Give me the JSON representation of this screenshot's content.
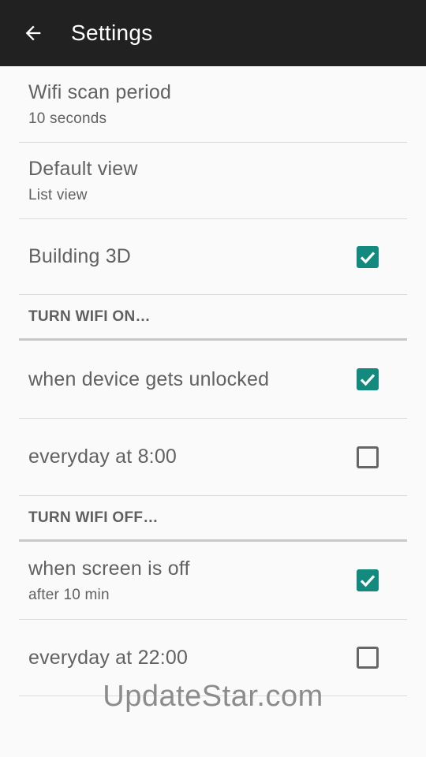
{
  "toolbar": {
    "title": "Settings",
    "back_icon": "arrow-back-icon"
  },
  "general": {
    "wifi_scan": {
      "title": "Wifi scan period",
      "summary": "10 seconds"
    },
    "default_view": {
      "title": "Default view",
      "summary": "List view"
    },
    "building_3d": {
      "title": "Building 3D",
      "checked": true
    }
  },
  "turn_on": {
    "header": "TURN WIFI ON…",
    "unlocked": {
      "title": "when device gets unlocked",
      "checked": true
    },
    "morning": {
      "title": "everyday at 8:00",
      "checked": false
    }
  },
  "turn_off": {
    "header": "TURN WIFI OFF…",
    "screen_off": {
      "title": "when screen is off",
      "summary": "after 10 min",
      "checked": true
    },
    "evening": {
      "title": "everyday at 22:00",
      "checked": false
    }
  },
  "watermark": "UpdateStar.com",
  "colors": {
    "accent": "#138a7d",
    "toolbar": "#212121",
    "background": "#fafafa"
  }
}
